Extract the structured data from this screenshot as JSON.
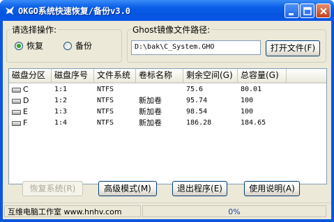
{
  "window": {
    "title": "OKGO系统快速恢复/备份v3.0",
    "icon": "app-bird-icon",
    "controls": [
      "minimize-icon",
      "maximize-icon",
      "close-icon"
    ]
  },
  "operation_group": {
    "legend": "请选择操作:",
    "options": [
      {
        "label": "恢复",
        "selected": true
      },
      {
        "label": "备份",
        "selected": false
      }
    ]
  },
  "path_group": {
    "legend": "Ghost镜像文件路径:",
    "value": "D:\\bak\\C_System.GHO",
    "open_button": "打开文件(F)"
  },
  "partition_table": {
    "columns": [
      "磁盘分区",
      "磁盘序号",
      "文件系统",
      "卷标名称",
      "剩余空间(G)",
      "总容量(G)"
    ],
    "rows": [
      {
        "partition": "C",
        "disk_no": "1:1",
        "fs": "NTFS",
        "label": "",
        "free": "75.6",
        "total": "80.01"
      },
      {
        "partition": "D",
        "disk_no": "1:2",
        "fs": "NTFS",
        "label": "新加卷",
        "free": "95.74",
        "total": "100"
      },
      {
        "partition": "E",
        "disk_no": "1:3",
        "fs": "NTFS",
        "label": "新加卷",
        "free": "98.54",
        "total": "100"
      },
      {
        "partition": "F",
        "disk_no": "1:4",
        "fs": "NTFS",
        "label": "新加卷",
        "free": "186.28",
        "total": "184.65"
      }
    ]
  },
  "buttons": {
    "restore": "恢复系统(R)",
    "advanced": "高级模式(M)",
    "exit": "退出程序(E)",
    "help": "使用说明(A)"
  },
  "statusbar": {
    "studio": "互维电脑工作室 www.hnhv.com",
    "progress": "0%"
  },
  "colors": {
    "titlebar": "#0a56e0",
    "face": "#ece9d8",
    "selected_radio": "#26a829"
  }
}
